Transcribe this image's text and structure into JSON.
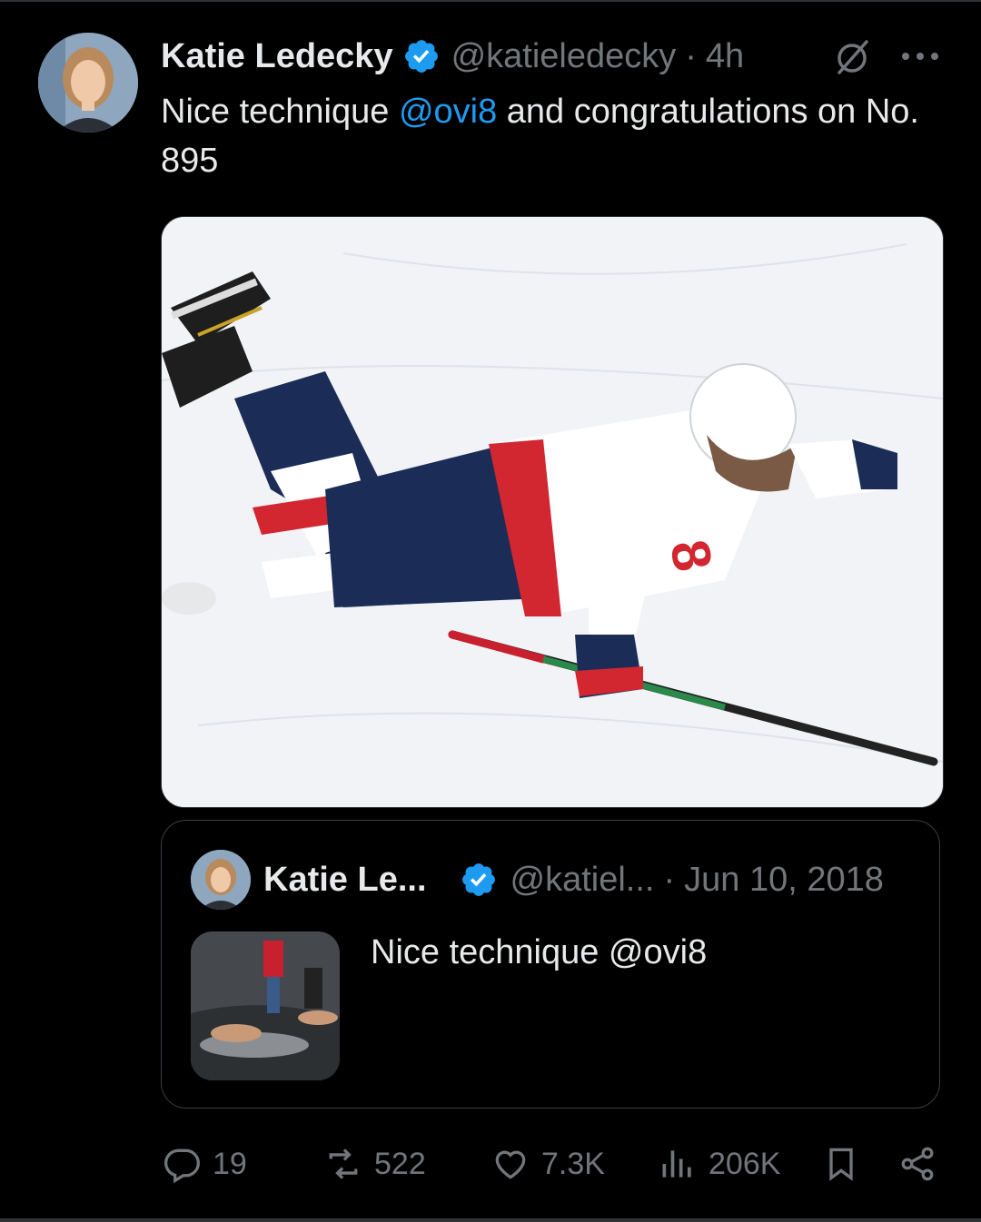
{
  "tweet": {
    "author_name": "Katie Ledecky",
    "handle": "@katieledecky",
    "separator": "·",
    "time": "4h",
    "text_before": "Nice technique ",
    "mention": "@ovi8",
    "text_after": " and congratulations on No. 895",
    "media_description": "hockey-player-sliding-on-ice"
  },
  "quoted": {
    "author_name": "Katie Le...",
    "handle": "@katiel...",
    "separator": "·",
    "date": "Jun 10, 2018",
    "text": "Nice technique @ovi8"
  },
  "actions": {
    "replies": "19",
    "reposts": "522",
    "likes": "7.3K",
    "views": "206K"
  },
  "colors": {
    "background": "#000000",
    "text": "#e7e9ea",
    "secondary": "#71767b",
    "accent": "#1d9bf0",
    "border": "#2f3336"
  },
  "icons": [
    "verified-badge-icon",
    "grok-icon",
    "more-icon",
    "reply-icon",
    "repost-icon",
    "like-icon",
    "views-icon",
    "bookmark-icon",
    "share-icon"
  ]
}
